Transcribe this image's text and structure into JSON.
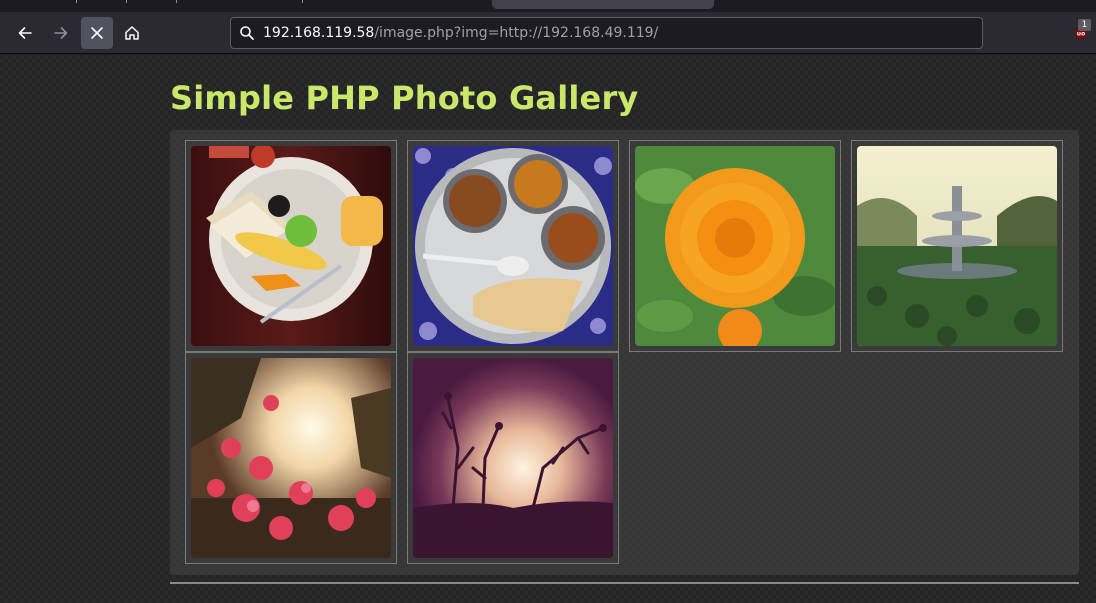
{
  "browser": {
    "url_host": "192.168.119.58",
    "url_path": "/image.php?img=http://192.168.49.119/",
    "extension_badge": "1",
    "icons": {
      "back": "arrow-left-icon",
      "forward": "arrow-right-icon",
      "stop": "close-icon",
      "home": "home-icon",
      "search": "search-icon",
      "extension": "ublock-icon"
    }
  },
  "page": {
    "title": "Simple PHP Photo Gallery",
    "title_color": "#c9e86b",
    "photos": [
      {
        "subject": "breakfast plate with toast, banana, lime and juice"
      },
      {
        "subject": "thali plate with curries and chapati"
      },
      {
        "subject": "orange marigold flower"
      },
      {
        "subject": "garden fountain"
      },
      {
        "subject": "pink bougainvillea at sunset"
      },
      {
        "subject": "silhouetted plant against hazy sun"
      }
    ]
  }
}
